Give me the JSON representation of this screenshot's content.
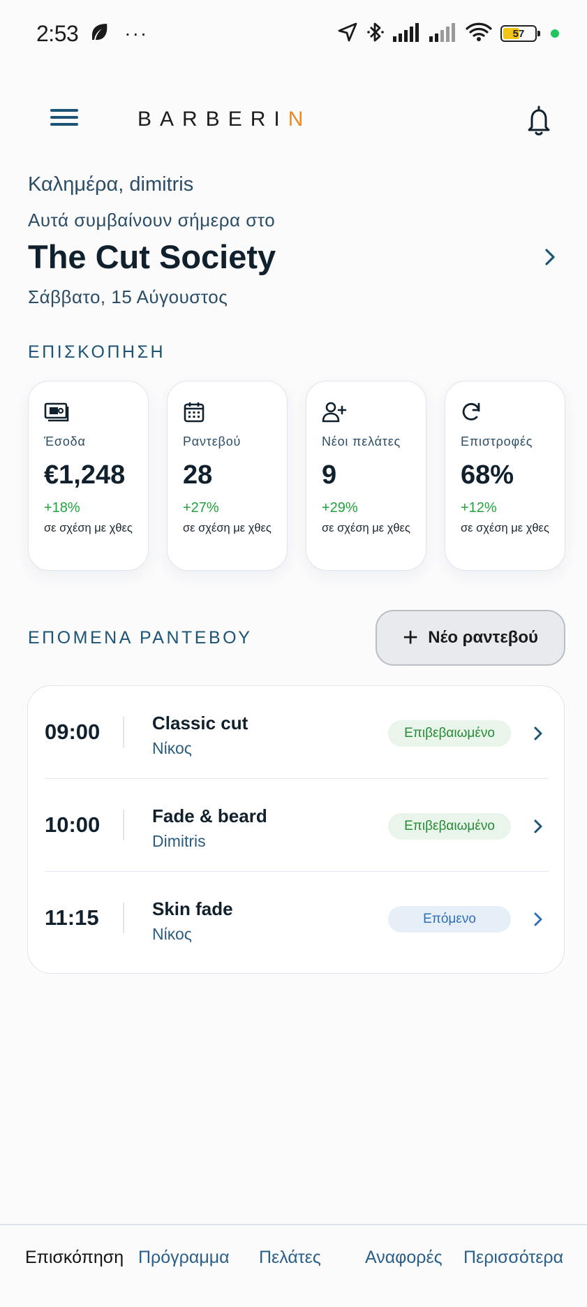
{
  "status_bar": {
    "time": "2:53",
    "more": "···",
    "battery_level": 57,
    "battery_text": "57",
    "battery_color": "#f3c518",
    "privacy_dot_color": "#21c55d"
  },
  "app_bar": {
    "logo_main": "BARBERI",
    "logo_accent": "N",
    "logo_accent_color": "#e98a1f",
    "menu_icon": "hamburger-icon",
    "bell_icon": "bell-icon"
  },
  "header": {
    "greeting": "Καλημέρα, dimitris",
    "subline": "Αυτά συμβαίνουν σήμερα στο",
    "shop_name": "The Cut Society",
    "date": "Σάββατο, 15 Αύγουστος"
  },
  "overview": {
    "title": "ΕΠΙΣΚΟΠΗΣΗ",
    "cards": [
      {
        "icon": "money-icon",
        "label": "Έσοδα",
        "value": "€1,248",
        "change": "+18%",
        "compare": "σε σχέση με χθες"
      },
      {
        "icon": "calendar-icon",
        "label": "Ραντεβού",
        "value": "28",
        "change": "+27%",
        "compare": "σε σχέση με χθες"
      },
      {
        "icon": "user-plus-icon",
        "label": "Νέοι πελάτες",
        "value": "9",
        "change": "+29%",
        "compare": "σε σχέση με χθες"
      },
      {
        "icon": "refresh-icon",
        "label": "Επιστροφές",
        "value": "68%",
        "change": "+12%",
        "compare": "σε σχέση με χθες"
      }
    ]
  },
  "upcoming": {
    "title": "ΕΠΟΜΕΝΑ ΡΑΝΤΕΒΟΥ",
    "new_button": {
      "plus": "+",
      "label": "Νέο ραντεβού"
    },
    "appointments": [
      {
        "time": "09:00",
        "service": "Classic cut",
        "client": "Νίκος",
        "status": "Επιβεβαιωμένο"
      },
      {
        "time": "10:00",
        "service": "Fade & beard",
        "client": "Dimitris",
        "status": "Επιβεβαιωμένο"
      },
      {
        "time": "11:15",
        "service": "Skin fade",
        "client": "Νίκος",
        "status": "Επόμενο"
      }
    ]
  },
  "bottom_nav": {
    "items": [
      {
        "label": "Επισκόπηση",
        "active": true
      },
      {
        "label": "Πρόγραμμα",
        "active": false
      },
      {
        "label": "Πελάτες",
        "active": false
      },
      {
        "label": "Αναφορές",
        "active": false
      },
      {
        "label": "Περισσότερα",
        "active": false
      }
    ]
  },
  "colors": {
    "primary": "#1c5476",
    "positive": "#1fa33a",
    "confirmed_badge_bg": "#e9f5ea",
    "next_badge_bg": "#e6eef8"
  }
}
